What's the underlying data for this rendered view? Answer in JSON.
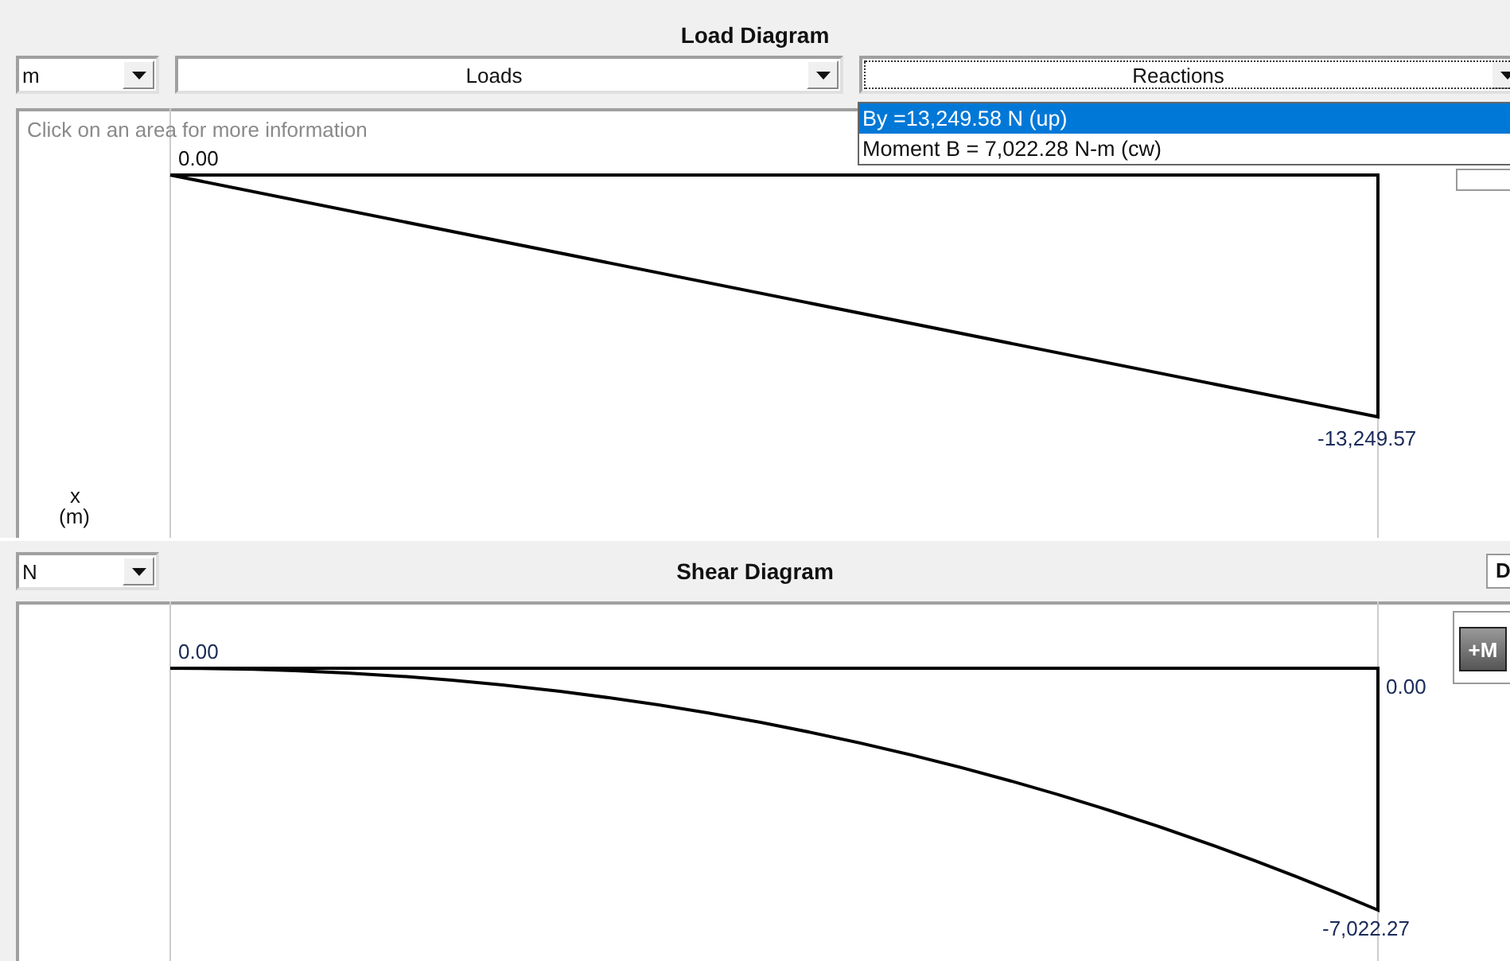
{
  "load_panel": {
    "title": "Load Diagram",
    "unit_combo": {
      "value": "m"
    },
    "loads_combo": {
      "value": "Loads"
    },
    "reactions_combo": {
      "value": "Reactions",
      "expanded": true,
      "options": [
        {
          "label": "By =13,249.58 N (up)",
          "selected": true
        },
        {
          "label": "Moment B = 7,022.28 N-m (cw)",
          "selected": false
        }
      ]
    },
    "hint": "Click on an area for more information",
    "start_label": "0.00",
    "end_label": "-13,249.57",
    "axis_label": "x",
    "axis_unit": "(m)"
  },
  "shear_panel": {
    "title": "Shear Diagram",
    "unit_combo": {
      "value": "N"
    },
    "moment_button": "+M",
    "cut_button": "D",
    "start_label": "0.00",
    "right_label": "0.00",
    "end_label": "-7,022.27"
  }
}
